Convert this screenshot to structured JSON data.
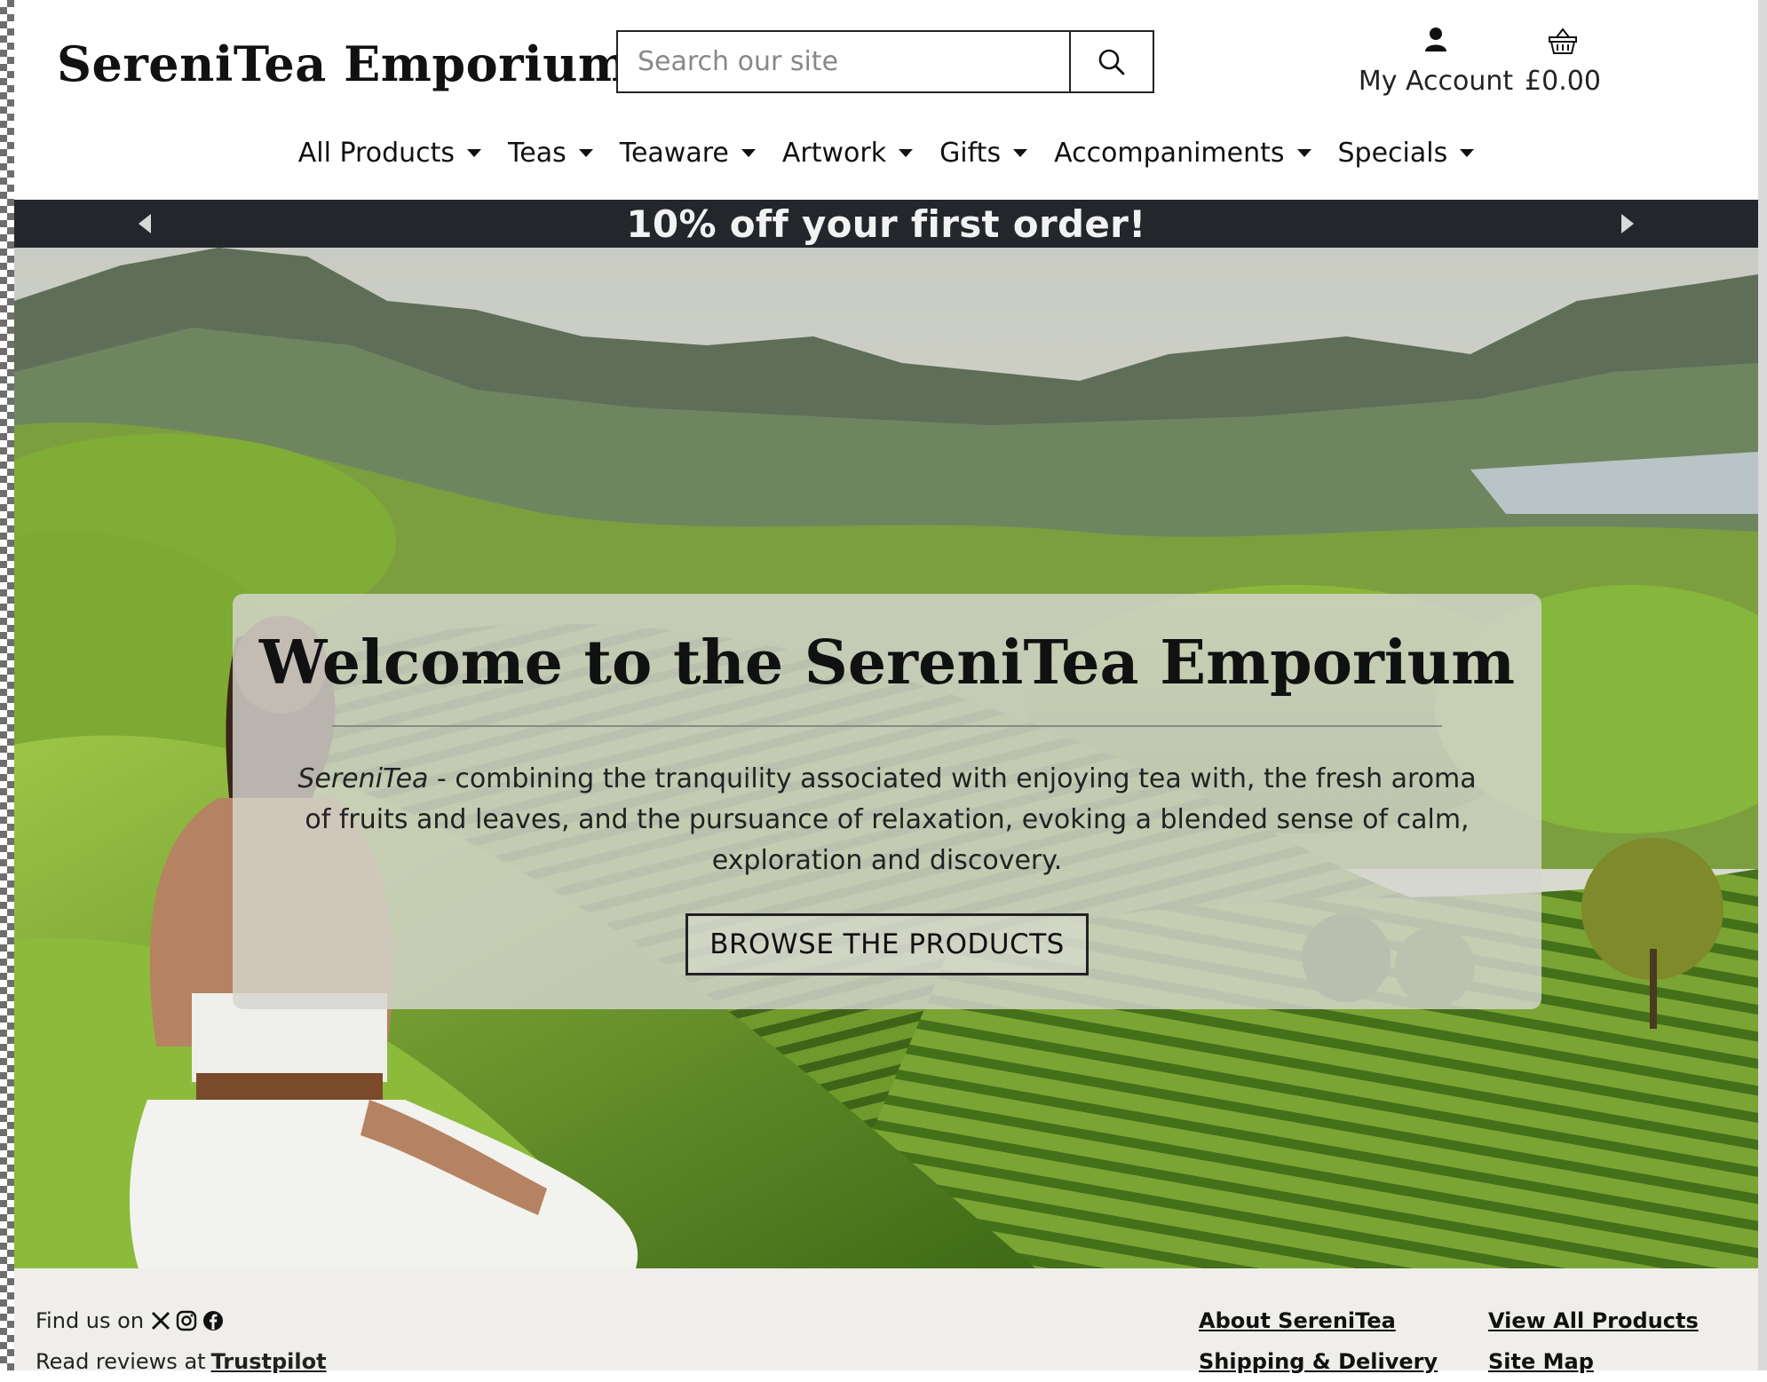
{
  "brand": {
    "name": "SereniTea Emporium"
  },
  "search": {
    "placeholder": "Search our site",
    "icon": "search-icon"
  },
  "account": {
    "label": "My Account",
    "icon": "user-icon"
  },
  "basket": {
    "total": "£0.00",
    "icon": "basket-icon"
  },
  "nav": {
    "items": [
      {
        "label": "All Products"
      },
      {
        "label": "Teas"
      },
      {
        "label": "Teaware"
      },
      {
        "label": "Artwork"
      },
      {
        "label": "Gifts"
      },
      {
        "label": "Accompaniments"
      },
      {
        "label": "Specials"
      }
    ]
  },
  "promo": {
    "text": "10% off your first order!"
  },
  "hero": {
    "title": "Welcome to the SereniTea Emporium",
    "intro_brand": "SereniTea",
    "intro_rest": " - combining the tranquility associated with enjoying tea with, the fresh aroma of fruits and leaves, and the pursuance of relaxation, evoking a blended sense of calm, exploration and discovery.",
    "cta_label": "BROWSE THE PRODUCTS"
  },
  "footer": {
    "find_us": "Find us on",
    "reviews_prefix": "Read reviews at",
    "reviews_link": "Trustpilot",
    "social_icons": [
      "x-icon",
      "instagram-icon",
      "facebook-icon"
    ],
    "col1": [
      "About SereniTea",
      "Shipping & Delivery"
    ],
    "col2": [
      "View All Products",
      "Site Map"
    ]
  },
  "colors": {
    "promo_bg": "#23272b",
    "footer_bg": "#efeeea",
    "hill_green": "#6f9a2c"
  }
}
